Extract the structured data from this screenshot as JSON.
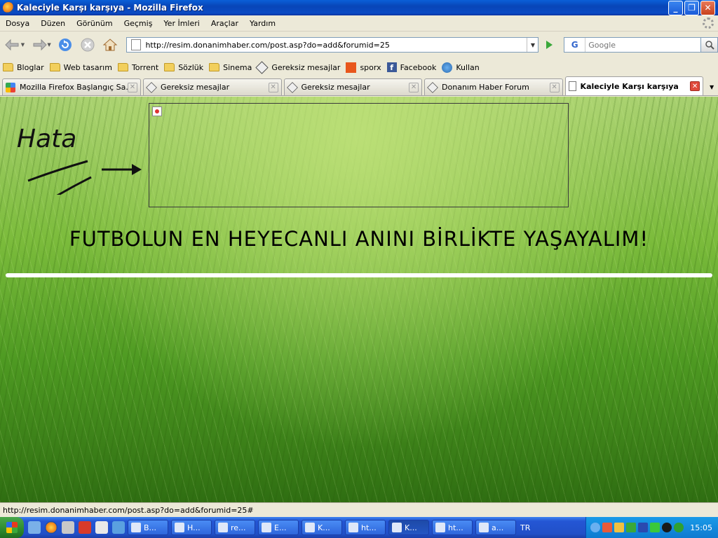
{
  "window": {
    "title": "Kaleciyle Karşı karşıya - Mozilla Firefox"
  },
  "menu": [
    "Dosya",
    "Düzen",
    "Görünüm",
    "Geçmiş",
    "Yer İmleri",
    "Araçlar",
    "Yardım"
  ],
  "nav": {
    "url": "http://resim.donanimhaber.com/post.asp?do=add&forumid=25",
    "search_placeholder": "Google",
    "search_engine": "G"
  },
  "bookmarks": [
    {
      "label": "Bloglar",
      "icon": "folder-icon"
    },
    {
      "label": "Web tasarım",
      "icon": "folder-icon"
    },
    {
      "label": "Torrent",
      "icon": "folder-icon"
    },
    {
      "label": "Sözlük",
      "icon": "folder-icon"
    },
    {
      "label": "Sinema",
      "icon": "folder-icon"
    },
    {
      "label": "Gereksiz mesajlar",
      "icon": "gereksiz-icon"
    },
    {
      "label": "sporx",
      "icon": "sporx-icon"
    },
    {
      "label": "Facebook",
      "icon": "facebook-icon"
    },
    {
      "label": "Kullan",
      "icon": "kullan-icon"
    }
  ],
  "tabs": [
    {
      "label": "Mozilla Firefox Başlangıç Sa...",
      "icon": "google-icon",
      "active": false
    },
    {
      "label": "Gereksiz mesajlar",
      "icon": "gereksiz-icon",
      "active": false
    },
    {
      "label": "Gereksiz mesajlar",
      "icon": "gereksiz-icon",
      "active": false
    },
    {
      "label": "Donanım Haber Forum",
      "icon": "gereksiz-icon",
      "active": false
    },
    {
      "label": "Kaleciyle Karşı karşıya",
      "icon": "document-icon",
      "active": true
    }
  ],
  "content": {
    "handwritten_note": "Hata",
    "banner": "FUTBOLUN EN HEYECANLI ANINI BİRLİKTE YAŞAYALIM!"
  },
  "status": {
    "text": "http://resim.donanimhaber.com/post.asp?do=add&forumid=25#"
  },
  "taskbar": {
    "tasks": [
      "B...",
      "H...",
      "re...",
      "E...",
      "K...",
      "ht...",
      "K...",
      "ht...",
      "a..."
    ],
    "active_index": 6,
    "language": "TR",
    "clock": "15:05"
  }
}
